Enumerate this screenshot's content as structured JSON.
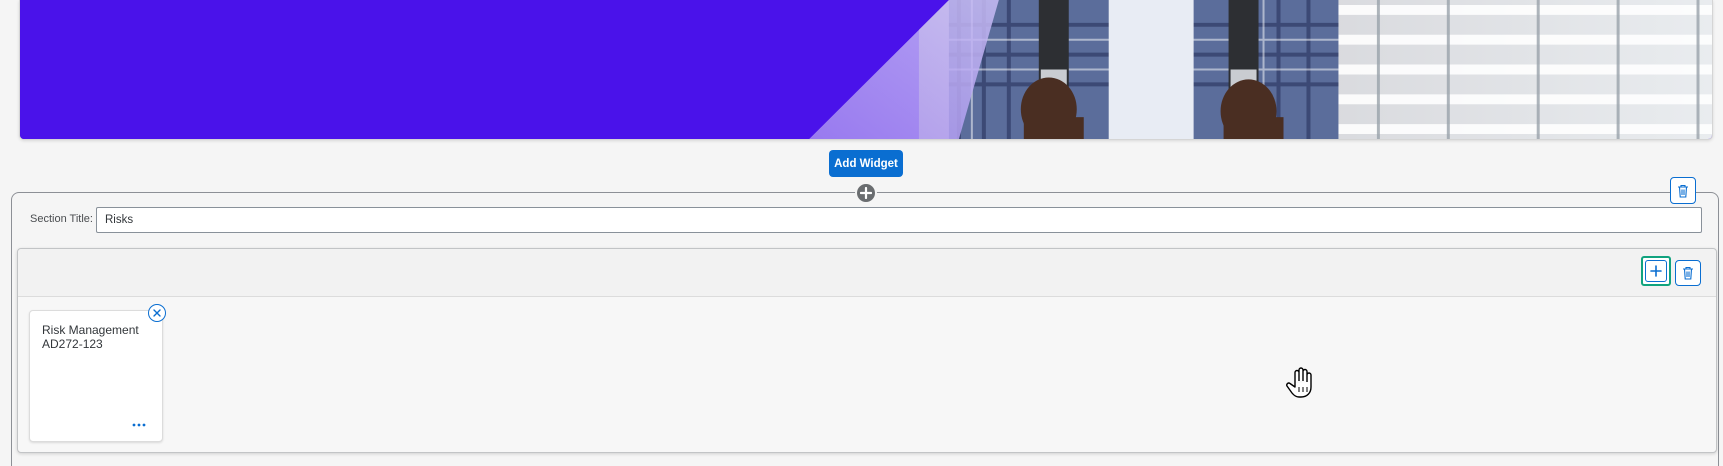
{
  "banner": {
    "background_color": "#4a12ea",
    "image": "student-with-backpack-photo"
  },
  "add_widget": {
    "label": "Add Widget",
    "color": "#0a6ed1"
  },
  "section": {
    "title_label": "Section Title:",
    "title_value": "Risks",
    "add_icon": "plus-circle-icon",
    "delete_icon": "trash-icon"
  },
  "container": {
    "add_icon": "plus-icon",
    "delete_icon": "trash-icon",
    "highlight_color": "#11a37f"
  },
  "tiles": [
    {
      "title": "Risk Management",
      "subtitle": "AD272-123",
      "remove_icon": "close-circle-icon",
      "more_icon": "more-dots-icon"
    }
  ],
  "cursor": {
    "icon": "hand-cursor-icon"
  }
}
